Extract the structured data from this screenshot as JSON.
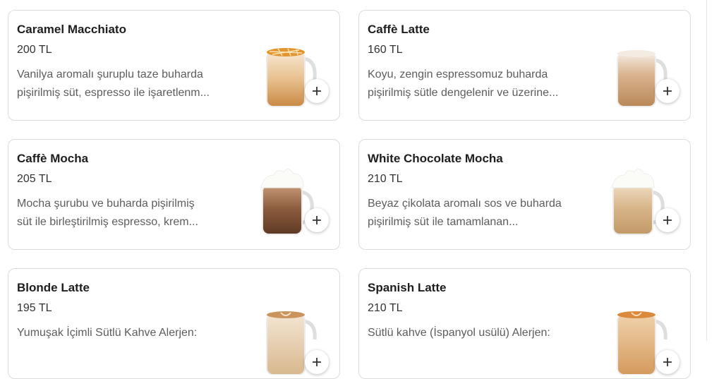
{
  "products": [
    {
      "name": "Caramel Macchiato",
      "price": "200 TL",
      "desc1": "Vanilya aromalı şuruplu taze buharda",
      "desc2": "pişirilmiş süt, espresso ile işaretlenm...",
      "icon": "caramel-macchiato-image"
    },
    {
      "name": "Caffè Latte",
      "price": "160 TL",
      "desc1": "Koyu, zengin espressomuz buharda",
      "desc2": "pişirilmiş sütle dengelenir ve üzerine...",
      "icon": "caffe-latte-image"
    },
    {
      "name": "Caffè Mocha",
      "price": "205 TL",
      "desc1": "Mocha şurubu ve buharda pişirilmiş",
      "desc2": "süt ile birleştirilmiş espresso, krem...",
      "icon": "caffe-mocha-image"
    },
    {
      "name": "White Chocolate Mocha",
      "price": "210 TL",
      "desc1": "Beyaz çikolata aromalı sos ve buharda",
      "desc2": "pişirilmiş süt ile tamamlanan...",
      "icon": "white-chocolate-mocha-image"
    },
    {
      "name": "Blonde Latte",
      "price": "195 TL",
      "desc1": "Yumuşak İçimli Sütlü Kahve Alerjen:",
      "desc2": "",
      "icon": "blonde-latte-image"
    },
    {
      "name": "Spanish Latte",
      "price": "210 TL",
      "desc1": "Sütlü kahve (İspanyol usülü) Alerjen:",
      "desc2": "",
      "icon": "spanish-latte-image"
    }
  ],
  "add_icon": "plus-icon",
  "colors": {
    "border": "#dcdcdc",
    "text": "#1e1e1e",
    "muted": "#5d5d5d"
  }
}
